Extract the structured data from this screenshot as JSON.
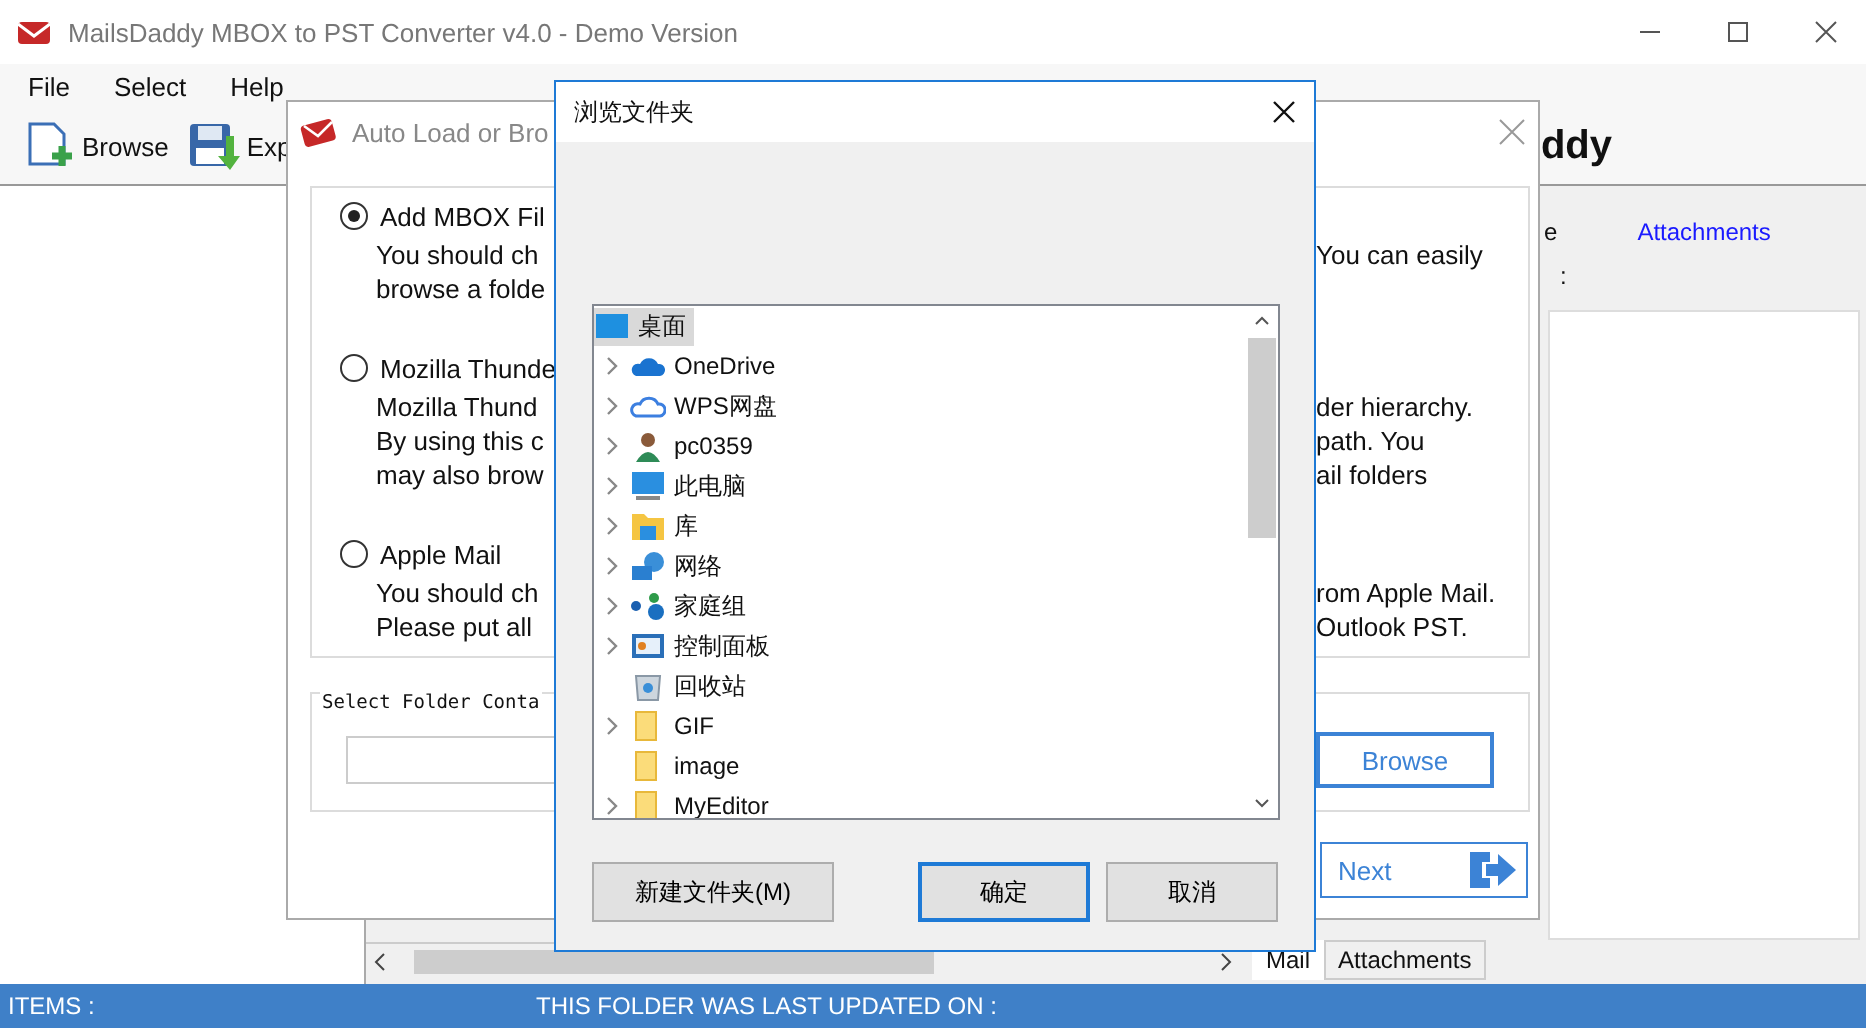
{
  "main_window": {
    "title": "MailsDaddy MBOX to PST Converter v4.0 - Demo Version",
    "menu": [
      "File",
      "Select",
      "Help"
    ],
    "toolbar": [
      {
        "kind": "browse",
        "label": "Browse"
      },
      {
        "kind": "export",
        "label": "Exp"
      }
    ],
    "logo_text": "ddy",
    "preview_header": {
      "column_1": "e",
      "column_2": "Attachments",
      "field_label": ":"
    },
    "preview_tabs": [
      {
        "label": "Mail",
        "selected": true
      },
      {
        "label": "Attachments",
        "selected": false
      }
    ],
    "status_bar": {
      "items_label": "ITEMS :",
      "updated_label": "THIS FOLDER WAS LAST UPDATED ON :"
    }
  },
  "import_dialog": {
    "title": "Auto Load or Bro",
    "options": [
      {
        "label": "Add MBOX Fil",
        "selected": true,
        "lines_left": [
          "You should ch",
          "browse a folde"
        ],
        "lines_right": [
          "You can easily"
        ]
      },
      {
        "label": "Mozilla Thunde",
        "selected": false,
        "lines_left": [
          "Mozilla Thund",
          "By using this c",
          "may also brow"
        ],
        "lines_right": [
          "der hierarchy.",
          "path. You",
          "ail folders"
        ]
      },
      {
        "label": "Apple Mail",
        "selected": false,
        "lines_left": [
          "You should ch",
          "Please put all"
        ],
        "lines_right": [
          "rom Apple Mail.",
          "Outlook PST."
        ]
      }
    ],
    "folder_group": {
      "legend": "Select Folder Conta",
      "browse_button": "Browse"
    },
    "next_button": "Next"
  },
  "browse_dialog": {
    "title": "浏览文件夹",
    "tree": [
      {
        "kind": "desktop",
        "label": "桌面",
        "expandable": false,
        "selected": true
      },
      {
        "kind": "cloud",
        "label": "OneDrive",
        "expandable": true,
        "selected": false
      },
      {
        "kind": "cloud-outline",
        "label": "WPS网盘",
        "expandable": true,
        "selected": false
      },
      {
        "kind": "user",
        "label": "pc0359",
        "expandable": true,
        "selected": false
      },
      {
        "kind": "computer",
        "label": "此电脑",
        "expandable": true,
        "selected": false
      },
      {
        "kind": "library",
        "label": "库",
        "expandable": true,
        "selected": false
      },
      {
        "kind": "network",
        "label": "网络",
        "expandable": true,
        "selected": false
      },
      {
        "kind": "homegroup",
        "label": "家庭组",
        "expandable": true,
        "selected": false
      },
      {
        "kind": "control-panel",
        "label": "控制面板",
        "expandable": true,
        "selected": false
      },
      {
        "kind": "recycle-bin",
        "label": "回收站",
        "expandable": false,
        "selected": false
      },
      {
        "kind": "folder",
        "label": "GIF",
        "expandable": true,
        "selected": false
      },
      {
        "kind": "folder",
        "label": "image",
        "expandable": false,
        "selected": false
      },
      {
        "kind": "folder",
        "label": "MyEditor",
        "expandable": true,
        "selected": false
      }
    ],
    "buttons": [
      {
        "label": "新建文件夹(M)",
        "default": false
      },
      {
        "label": "确定",
        "default": true
      },
      {
        "label": "取消",
        "default": false
      }
    ]
  }
}
